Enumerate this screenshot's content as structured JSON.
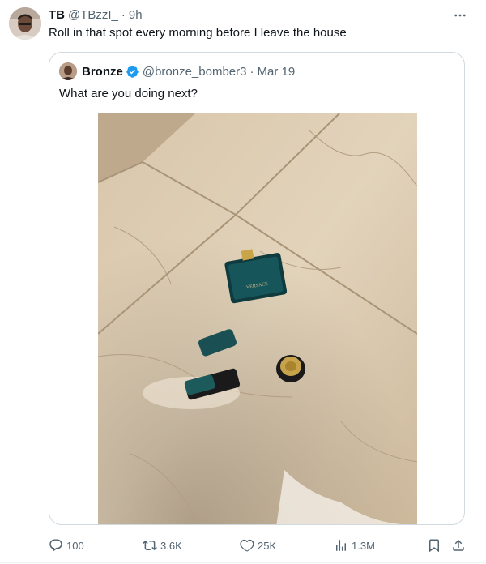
{
  "tweet": {
    "name": "TB",
    "handle": "@TBzzI_",
    "separator": "·",
    "time": "9h",
    "text": "Roll in that spot every morning before I leave the house",
    "more_icon": "more-dots-icon"
  },
  "quote": {
    "name": "Bronze",
    "verified": true,
    "handle": "@bronze_bomber3",
    "separator": "·",
    "time": "Mar 19",
    "text": "What are you doing next?",
    "image_alt": "Broken Versace Eros perfume bottle on a marble tile floor",
    "image_text": "VERSACE"
  },
  "actions": {
    "replies": "100",
    "retweets": "3.6K",
    "likes": "25K",
    "views": "1.3M"
  },
  "colors": {
    "text": "#0f1419",
    "secondary": "#536471",
    "border": "#cfd9de",
    "verified": "#1d9bf0"
  }
}
